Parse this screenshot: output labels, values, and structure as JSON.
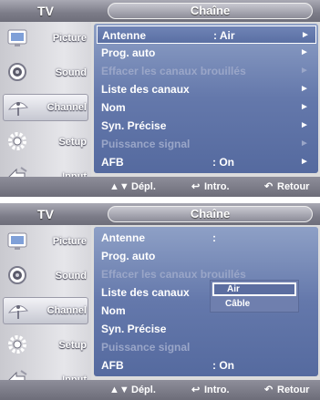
{
  "screens": [
    {
      "tv_label": "TV",
      "title": "Chaîne",
      "sidebar": [
        {
          "label": "Picture",
          "icon": "picture-icon",
          "selected": false
        },
        {
          "label": "Sound",
          "icon": "sound-icon",
          "selected": false
        },
        {
          "label": "Channel",
          "icon": "channel-icon",
          "selected": true
        },
        {
          "label": "Setup",
          "icon": "setup-icon",
          "selected": false
        },
        {
          "label": "Input",
          "icon": "input-icon",
          "selected": false
        }
      ],
      "rows": [
        {
          "label": "Antenne",
          "value": ": Air",
          "arrow": "►",
          "disabled": false,
          "selected": true
        },
        {
          "label": "Prog. auto",
          "value": "",
          "arrow": "►",
          "disabled": false,
          "selected": false
        },
        {
          "label": "Effacer les canaux brouillés",
          "value": "",
          "arrow": "►",
          "disabled": true,
          "selected": false
        },
        {
          "label": "Liste des canaux",
          "value": "",
          "arrow": "►",
          "disabled": false,
          "selected": false
        },
        {
          "label": "Nom",
          "value": "",
          "arrow": "►",
          "disabled": false,
          "selected": false
        },
        {
          "label": "Syn. Précise",
          "value": "",
          "arrow": "►",
          "disabled": false,
          "selected": false
        },
        {
          "label": "Puissance signal",
          "value": "",
          "arrow": "►",
          "disabled": true,
          "selected": false
        },
        {
          "label": "AFB",
          "value": ": On",
          "arrow": "►",
          "disabled": false,
          "selected": false
        }
      ],
      "hints": {
        "move": "Dépl.",
        "enter": "Intro.",
        "return": "Retour"
      }
    },
    {
      "tv_label": "TV",
      "title": "Chaîne",
      "sidebar": [
        {
          "label": "Picture",
          "icon": "picture-icon",
          "selected": false
        },
        {
          "label": "Sound",
          "icon": "sound-icon",
          "selected": false
        },
        {
          "label": "Channel",
          "icon": "channel-icon",
          "selected": true
        },
        {
          "label": "Setup",
          "icon": "setup-icon",
          "selected": false
        },
        {
          "label": "Input",
          "icon": "input-icon",
          "selected": false
        }
      ],
      "rows": [
        {
          "label": "Antenne",
          "value": ":",
          "arrow": "",
          "disabled": false,
          "selected": false
        },
        {
          "label": "Prog. auto",
          "value": "",
          "arrow": "",
          "disabled": false,
          "selected": false
        },
        {
          "label": "Effacer les canaux brouillés",
          "value": "",
          "arrow": "",
          "disabled": true,
          "selected": false
        },
        {
          "label": "Liste des canaux",
          "value": "",
          "arrow": "",
          "disabled": false,
          "selected": false
        },
        {
          "label": "Nom",
          "value": "",
          "arrow": "",
          "disabled": false,
          "selected": false
        },
        {
          "label": "Syn. Précise",
          "value": "",
          "arrow": "",
          "disabled": false,
          "selected": false
        },
        {
          "label": "Puissance signal",
          "value": "",
          "arrow": "",
          "disabled": true,
          "selected": false
        },
        {
          "label": "AFB",
          "value": ": On",
          "arrow": "",
          "disabled": false,
          "selected": false
        }
      ],
      "dropdown": {
        "options": [
          "Air",
          "Câble"
        ],
        "selected": "Air"
      },
      "hints": {
        "move": "Dépl.",
        "enter": "Intro.",
        "return": "Retour"
      }
    }
  ],
  "colors": {
    "menu_blue": "#6478ab",
    "disabled_text": "#9aa6c8",
    "sidebar_gray": "#e6e6ea"
  }
}
